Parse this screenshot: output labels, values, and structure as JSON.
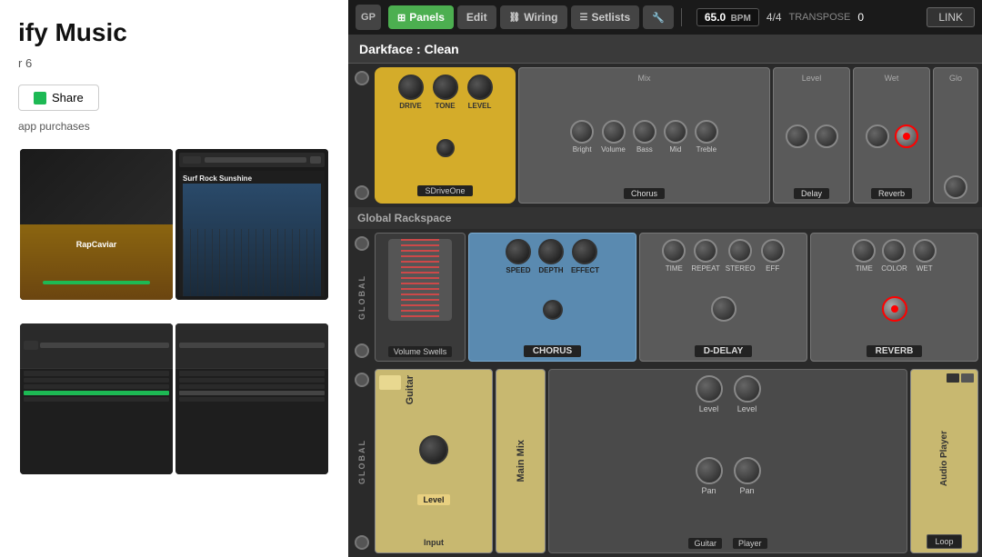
{
  "left": {
    "title": "ify Music",
    "subtitle": "r 6",
    "shareLabel": "Share",
    "appPurchasesLabel": "app purchases",
    "screenshot1": {
      "artist": "RapCaviar"
    },
    "screenshot2": {
      "artist": "Surf Rock Sunshine"
    }
  },
  "toolbar": {
    "logo": "GP",
    "panelsLabel": "Panels",
    "editLabel": "Edit",
    "wiringLabel": "Wiring",
    "setlistsLabel": "Setlists",
    "bpm": "65.0",
    "bpmUnit": "BPM",
    "signature": "4/4",
    "transposeLabel": "TRANSPOSE",
    "transposeValue": "0",
    "linkLabel": "LINK"
  },
  "preset": {
    "name": "Darkface : Clean"
  },
  "upperRack": {
    "pedal": {
      "knobs": [
        "DRIVE",
        "TONE",
        "LEVEL"
      ],
      "name": "SDriveOne"
    },
    "chorus": {
      "label": "Mix",
      "knobs": [
        "Bright",
        "Volume",
        "Bass",
        "Mid",
        "Treble"
      ],
      "name": "Chorus"
    },
    "delay": {
      "label": "Level",
      "name": "Delay"
    },
    "reverb": {
      "label": "Wet",
      "name": "Reverb"
    },
    "glo": {
      "name": "Glo"
    }
  },
  "globalRackspace": {
    "label": "Global Rackspace",
    "row1": {
      "blocks": [
        {
          "name": "Volume Swells",
          "type": "wah"
        },
        {
          "name": "CHORUS",
          "type": "chorus",
          "knobs": [
            "SPEED",
            "DEPTH",
            "EFFECT"
          ]
        },
        {
          "name": "D-DELAY",
          "type": "delay",
          "knobs": [
            "TIME",
            "REPEAT",
            "STEREO",
            "EFF"
          ]
        },
        {
          "name": "REVERB",
          "type": "reverb",
          "knobs": [
            "TIME",
            "COLOR",
            "WET"
          ]
        }
      ]
    },
    "row2": {
      "blocks": [
        {
          "name": "Guitar",
          "type": "guitar",
          "levelLabel": "Level",
          "inputLabel": "Input"
        },
        {
          "name": "Main Mix",
          "type": "mix"
        },
        {
          "name": "Guitar",
          "levelLabel": "Level",
          "panLabel": "Pan",
          "type": "channel"
        },
        {
          "name": "Player",
          "type": "player",
          "loopLabel": "Loop"
        },
        {
          "name": "Audio Player",
          "type": "audio"
        }
      ]
    }
  }
}
